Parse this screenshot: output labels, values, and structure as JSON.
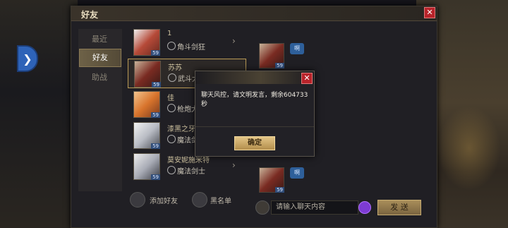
{
  "panel": {
    "title": "好友",
    "close_label": "✕"
  },
  "side_nav": {
    "arrow": "❯"
  },
  "tabs": [
    {
      "label": "最近",
      "active": false
    },
    {
      "label": "好友",
      "active": true
    },
    {
      "label": "助战",
      "active": false
    }
  ],
  "friends": [
    {
      "name": "1",
      "class": "角斗剑狂",
      "level": "59"
    },
    {
      "name": "苏苏",
      "class": "武斗大师",
      "level": "59"
    },
    {
      "name": "佳",
      "class": "枪炮大师",
      "level": "59"
    },
    {
      "name": "漆黑之牙",
      "class": "魔法剑士",
      "level": "59"
    },
    {
      "name": "莫安妮施米特",
      "class": "魔法剑士",
      "level": "59"
    }
  ],
  "chat_messages": [
    {
      "level": "59",
      "bubble": "啊"
    },
    {
      "level": "59",
      "bubble": "啊"
    },
    {
      "level": "59",
      "bubble": "啊"
    }
  ],
  "bottom_bar": {
    "add_friend": "添加好友",
    "blacklist": "黑名单",
    "input_placeholder": "请输入聊天内容",
    "send": "发 送"
  },
  "dialog": {
    "message": "聊天风控，请文明发言，剩余604733秒",
    "ok": "确定",
    "close": "✕"
  }
}
